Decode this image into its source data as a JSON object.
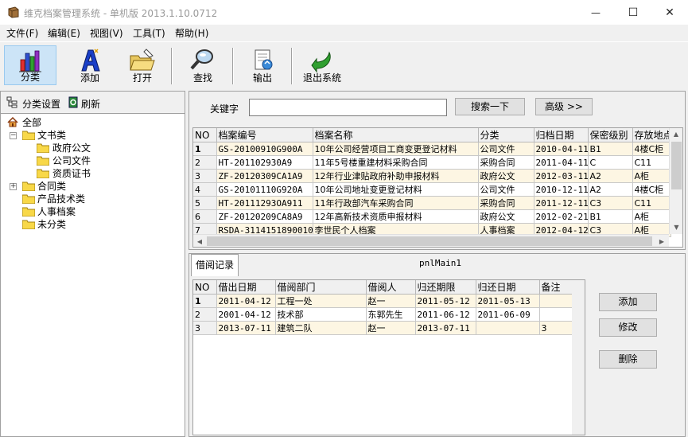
{
  "window": {
    "title": "维克档案管理系统 - 单机版 2013.1.10.0712",
    "min_glyph": "—",
    "max_glyph": "☐",
    "close_glyph": "✕"
  },
  "menu": [
    "文件(F)",
    "编辑(E)",
    "视图(V)",
    "工具(T)",
    "帮助(H)"
  ],
  "toolbar": {
    "classify": "分类",
    "add": "添加",
    "open": "打开",
    "find": "查找",
    "export": "输出",
    "exit": "退出系统"
  },
  "left": {
    "settings_label": "分类设置",
    "refresh_label": "刷新",
    "tree": {
      "root": "全部",
      "docs": "文书类",
      "gov": "政府公文",
      "company": "公司文件",
      "cert": "资质证书",
      "contract": "合同类",
      "product": "产品技术类",
      "hr": "人事档案",
      "uncat": "未分类",
      "expander_open": "−",
      "expander_closed": "+"
    }
  },
  "search": {
    "keyword_label": "关键字",
    "keyword_value": "",
    "search_button": "搜索一下",
    "advanced_button": "高级 >>"
  },
  "archive_table": {
    "headers": [
      "NO",
      "档案编号",
      "档案名称",
      "分类",
      "归档日期",
      "保密级别",
      "存放地点"
    ],
    "rows": [
      [
        "1",
        "GS-20100910G900A",
        "10年公司经营项目工商变更登记材料",
        "公司文件",
        "2010-04-11",
        "B1",
        "4楼C柜"
      ],
      [
        "2",
        "HT-201102930A9",
        "11年5号楼重建材料采购合同",
        "采购合同",
        "2011-04-11",
        "C",
        "C11"
      ],
      [
        "3",
        "ZF-20120309CA1A9",
        "12年行业津贴政府补助申报材料",
        "政府公文",
        "2012-03-11",
        "A2",
        "A柜"
      ],
      [
        "4",
        "GS-20101110G920A",
        "10年公司地址变更登记材料",
        "公司文件",
        "2010-12-11",
        "A2",
        "4楼C柜"
      ],
      [
        "5",
        "HT-20111293OA911",
        "11年行政部汽车采购合同",
        "采购合同",
        "2011-12-11",
        "C3",
        "C11"
      ],
      [
        "6",
        "ZF-20120209CA8A9",
        "12年高新技术资质申报材料",
        "政府公文",
        "2012-02-21",
        "B1",
        "A柜"
      ],
      [
        "7",
        "RSDA-31141518900102",
        "李世民个人档案",
        "人事档案",
        "2012-04-12",
        "C3",
        "A柜"
      ]
    ]
  },
  "tabs": {
    "borrow_tab": "借阅记录",
    "panel_label": "pnlMain1"
  },
  "borrow_table": {
    "headers": [
      "NO",
      "借出日期",
      "借阅部门",
      "借阅人",
      "归还期限",
      "归还日期",
      "备注"
    ],
    "rows": [
      [
        "1",
        "2011-04-12",
        "工程一处",
        "赵一",
        "2011-05-12",
        "2011-05-13",
        ""
      ],
      [
        "2",
        "2001-04-12",
        "技术部",
        "东郭先生",
        "2011-06-12",
        "2011-06-09",
        ""
      ],
      [
        "3",
        "2013-07-11",
        "建筑二队",
        "赵一",
        "2013-07-11",
        "",
        "3"
      ]
    ]
  },
  "borrow_buttons": {
    "add": "添加",
    "edit": "修改",
    "delete": "删除"
  },
  "scroll": {
    "up": "▲",
    "down": "▼",
    "left": "◀",
    "right": "▶"
  }
}
